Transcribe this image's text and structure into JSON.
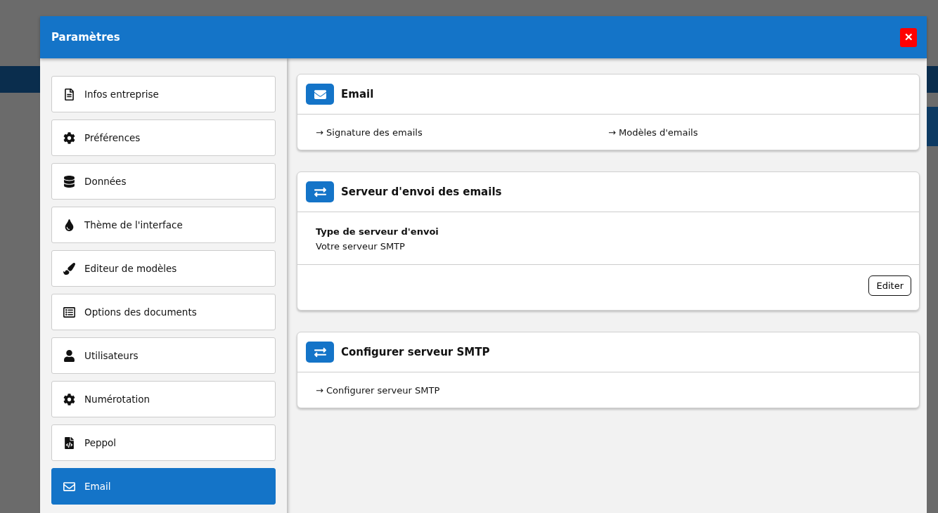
{
  "dialog": {
    "title": "Paramètres",
    "close": "✕"
  },
  "sidebar": {
    "items": [
      {
        "label": "Infos entreprise",
        "selected": false
      },
      {
        "label": "Préférences",
        "selected": false
      },
      {
        "label": "Données",
        "selected": false
      },
      {
        "label": "Thème de l'interface",
        "selected": false
      },
      {
        "label": "Editeur de modèles",
        "selected": false
      },
      {
        "label": "Options des documents",
        "selected": false
      },
      {
        "label": "Utilisateurs",
        "selected": false
      },
      {
        "label": "Numérotation",
        "selected": false
      },
      {
        "label": "Peppol",
        "selected": false
      },
      {
        "label": "Email",
        "selected": true
      }
    ]
  },
  "cards": [
    {
      "kind": "links",
      "title": "Email",
      "links": [
        "→ Signature des emails",
        "→ Modèles d'emails"
      ]
    },
    {
      "kind": "info",
      "title": "Serveur d'envoi des emails",
      "field_label": "Type de serveur d'envoi",
      "field_value": "Votre serveur SMTP",
      "button": "Editer"
    },
    {
      "kind": "links",
      "title": "Configurer serveur SMTP",
      "links": [
        "→ Configurer serveur SMTP"
      ]
    }
  ]
}
